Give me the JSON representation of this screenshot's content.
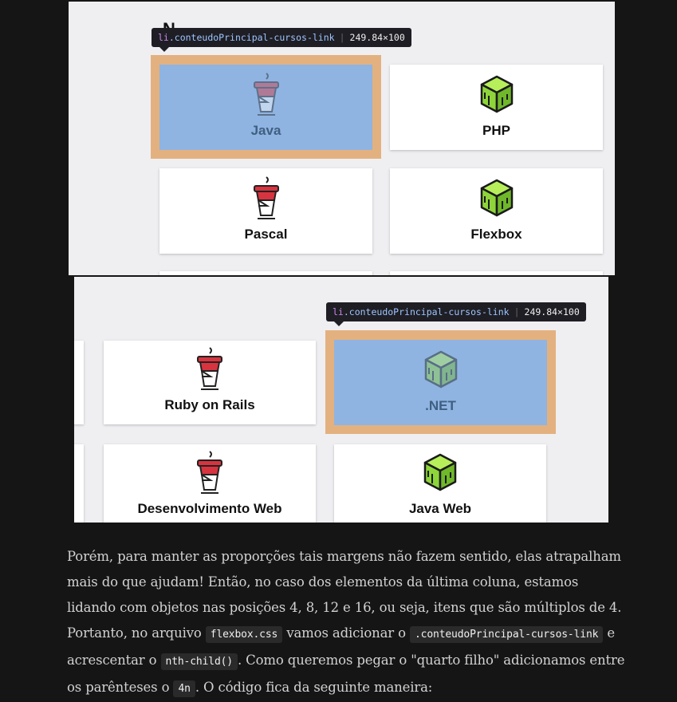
{
  "tooltip": {
    "tag": "li",
    "class_name": ".conteudoPrincipal-cursos-link",
    "dimensions": "249.84×100"
  },
  "screenshot_top": {
    "partial_heading": "N",
    "cards": [
      {
        "label": "Java",
        "icon": "coffee-cup-icon",
        "highlighted": true
      },
      {
        "label": "PHP",
        "icon": "green-cube-icon",
        "highlighted": false
      },
      {
        "label": "Pascal",
        "icon": "coffee-cup-icon",
        "highlighted": false
      },
      {
        "label": "Flexbox",
        "icon": "green-cube-icon",
        "highlighted": false
      }
    ]
  },
  "screenshot_bottom": {
    "cards": [
      {
        "label": "Ruby on Rails",
        "icon": "coffee-cup-icon",
        "highlighted": false
      },
      {
        "label": ".NET",
        "icon": "green-cube-icon",
        "highlighted": true
      },
      {
        "label": "Desenvolvimento Web",
        "icon": "coffee-cup-icon",
        "highlighted": false
      },
      {
        "label": "Java Web",
        "icon": "green-cube-icon",
        "highlighted": false
      }
    ]
  },
  "article": {
    "p1": "Porém, para manter as proporções tais margens não fazem sentido, elas atrapalham mais do que ajudam! Então, no caso dos elementos da última coluna, estamos lidando com objetos nas posições 4, 8, 12 e 16, ou seja, itens que são múltiplos de 4. Portanto, no arquivo",
    "code1": "flexbox.css",
    "p2": "vamos adicionar o",
    "code2": ".conteudoPrincipal-cursos-link",
    "p3": "e acrescentar o",
    "code3": "nth-child()",
    "p4": ". Como queremos pegar o \"quarto filho\" adicionamos entre os parênteses o",
    "code4": "4n",
    "p5": ". O código fica da seguinte maneira:"
  },
  "colors": {
    "page_background": "#151515",
    "highlight_margin": "#e3b17f",
    "highlight_content": "#8fb4e1",
    "cup_red": "#d8343f",
    "cube_green": "#8ed53a"
  }
}
